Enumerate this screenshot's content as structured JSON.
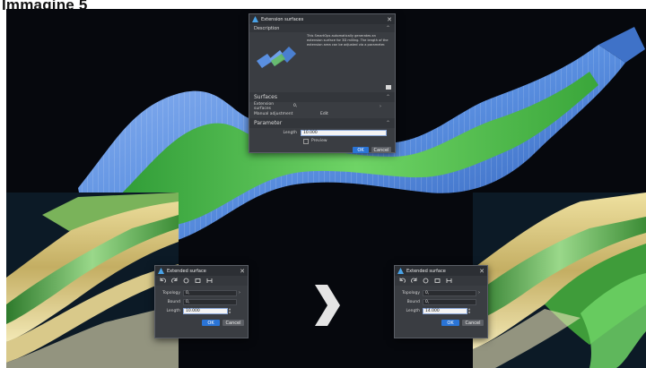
{
  "page": {
    "heading": "Immagine 5"
  },
  "main_dialog": {
    "title": "Extension surfaces",
    "description_header": "Description",
    "description_text": "This SmartOps automatically generates an extension surface for 3D milling. The length of the extension area can be adjusted via a parameter.",
    "surfaces_header": "Surfaces",
    "extension_surfaces_label": "Extension surfaces",
    "extension_surfaces_value": "0,",
    "manual_adjustment_label": "Manual adjustment",
    "edit_label": "Edit",
    "parameter_header": "Parameter",
    "length_label": "Length",
    "length_value": "10.000",
    "preview_label": "Preview",
    "ok_label": "OK",
    "cancel_label": "Cancel"
  },
  "left_dialog": {
    "title": "Extended surface",
    "topology_label": "Topology",
    "topology_value": "0,",
    "bound_label": "Bound",
    "bound_value": "0,",
    "length_label": "Length",
    "length_value": "10.000",
    "ok_label": "OK",
    "cancel_label": "Cancel"
  },
  "right_dialog": {
    "title": "Extended surface",
    "topology_label": "Topology",
    "topology_value": "0,",
    "bound_label": "Bound",
    "bound_value": "0,",
    "length_label": "Length",
    "length_value": "14.000",
    "ok_label": "OK",
    "cancel_label": "Cancel"
  },
  "icons": [
    "logo-icon",
    "close-icon",
    "collapse-icon",
    "undo-icon",
    "redo-icon",
    "filter-icon",
    "display-icon",
    "measure-icon",
    "next-arrow-icon"
  ],
  "colors": {
    "accent": "#2a74d6",
    "surface_blue": "#5a8fe0",
    "surface_green": "#4fb84a",
    "surface_gold": "#d8c57a"
  }
}
